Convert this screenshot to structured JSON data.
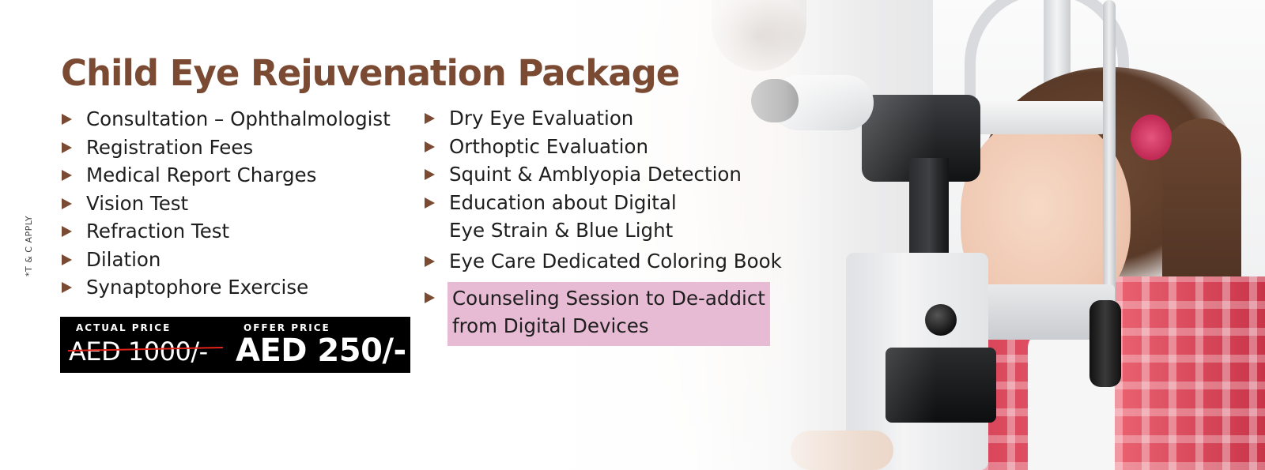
{
  "banner": {
    "title": "Child Eye Rejuvenation Package",
    "side_note": "*T & C APPLY",
    "bullet_icon": "triangle-right-icon",
    "colors": {
      "title": "#7a4a33",
      "bullet": "#7a4a33",
      "highlight": "#e7bbd4",
      "price_box": "#000000",
      "strike": "#e2231a"
    }
  },
  "services_left": [
    "Consultation – Ophthalmologist",
    "Registration Fees",
    "Medical Report Charges",
    "Vision Test",
    "Refraction Test",
    "Dilation",
    "Synaptophore Exercise"
  ],
  "services_right": {
    "dry_eye": "Dry Eye Evaluation",
    "orthoptic": "Orthoptic Evaluation",
    "squint": "Squint & Amblyopia Detection",
    "education_line1": "Education about Digital",
    "education_line2": "Eye Strain & Blue Light",
    "coloring_book": "Eye Care Dedicated Coloring Book",
    "counseling_line1": "Counseling Session to De-addict",
    "counseling_line2": "from Digital Devices"
  },
  "pricing": {
    "actual_label": "ACTUAL PRICE",
    "actual_price": "AED 1000/-",
    "offer_label": "OFFER PRICE",
    "offer_price": "AED 250/-"
  }
}
